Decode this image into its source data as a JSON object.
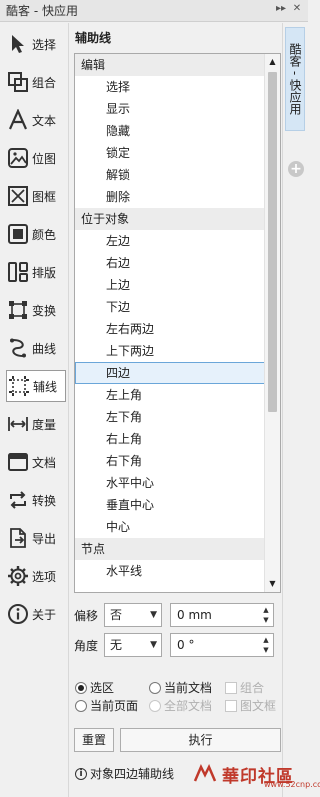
{
  "window": {
    "title": "酷客 - 快应用",
    "pin": "▸▸",
    "close": "✕"
  },
  "sidebar": {
    "items": [
      {
        "label": "选择",
        "icon": "cursor-icon"
      },
      {
        "label": "组合",
        "icon": "group-icon"
      },
      {
        "label": "文本",
        "icon": "text-icon"
      },
      {
        "label": "位图",
        "icon": "bitmap-icon"
      },
      {
        "label": "图框",
        "icon": "frame-icon"
      },
      {
        "label": "颜色",
        "icon": "color-icon"
      },
      {
        "label": "排版",
        "icon": "layout-icon"
      },
      {
        "label": "变换",
        "icon": "transform-icon"
      },
      {
        "label": "曲线",
        "icon": "curve-icon"
      },
      {
        "label": "辅线",
        "icon": "guideline-icon"
      },
      {
        "label": "度量",
        "icon": "measure-icon"
      },
      {
        "label": "文档",
        "icon": "document-icon"
      },
      {
        "label": "转换",
        "icon": "convert-icon"
      },
      {
        "label": "导出",
        "icon": "export-icon"
      },
      {
        "label": "选项",
        "icon": "gear-icon"
      },
      {
        "label": "关于",
        "icon": "info-icon"
      }
    ],
    "active_index": 9
  },
  "panel": {
    "title": "辅助线",
    "list": [
      {
        "type": "group",
        "label": "编辑"
      },
      {
        "type": "item",
        "label": "选择"
      },
      {
        "type": "item",
        "label": "显示"
      },
      {
        "type": "item",
        "label": "隐藏"
      },
      {
        "type": "item",
        "label": "锁定"
      },
      {
        "type": "item",
        "label": "解锁"
      },
      {
        "type": "item",
        "label": "删除"
      },
      {
        "type": "group",
        "label": "位于对象"
      },
      {
        "type": "item",
        "label": "左边"
      },
      {
        "type": "item",
        "label": "右边"
      },
      {
        "type": "item",
        "label": "上边"
      },
      {
        "type": "item",
        "label": "下边"
      },
      {
        "type": "item",
        "label": "左右两边"
      },
      {
        "type": "item",
        "label": "上下两边"
      },
      {
        "type": "item",
        "label": "四边",
        "selected": true
      },
      {
        "type": "item",
        "label": "左上角"
      },
      {
        "type": "item",
        "label": "左下角"
      },
      {
        "type": "item",
        "label": "右上角"
      },
      {
        "type": "item",
        "label": "右下角"
      },
      {
        "type": "item",
        "label": "水平中心"
      },
      {
        "type": "item",
        "label": "垂直中心"
      },
      {
        "type": "item",
        "label": "中心"
      },
      {
        "type": "group",
        "label": "节点"
      },
      {
        "type": "item",
        "label": "水平线"
      }
    ],
    "offset": {
      "label": "偏移",
      "select_value": "否",
      "spin_value": "0 mm"
    },
    "angle": {
      "label": "角度",
      "select_value": "无",
      "spin_value": "0 °"
    },
    "scope": {
      "selection": "选区",
      "current_doc": "当前文档",
      "group": "组合",
      "current_page": "当前页面",
      "all_docs": "全部文档",
      "graphic_frame": "图文框"
    },
    "reset_label": "重置",
    "execute_label": "执行",
    "hint": "对象四边辅助线"
  },
  "dock": {
    "tab_label": "酷客 - 快应用"
  },
  "watermark": {
    "brand": "華印社區",
    "url": "www.52cnp.com"
  }
}
